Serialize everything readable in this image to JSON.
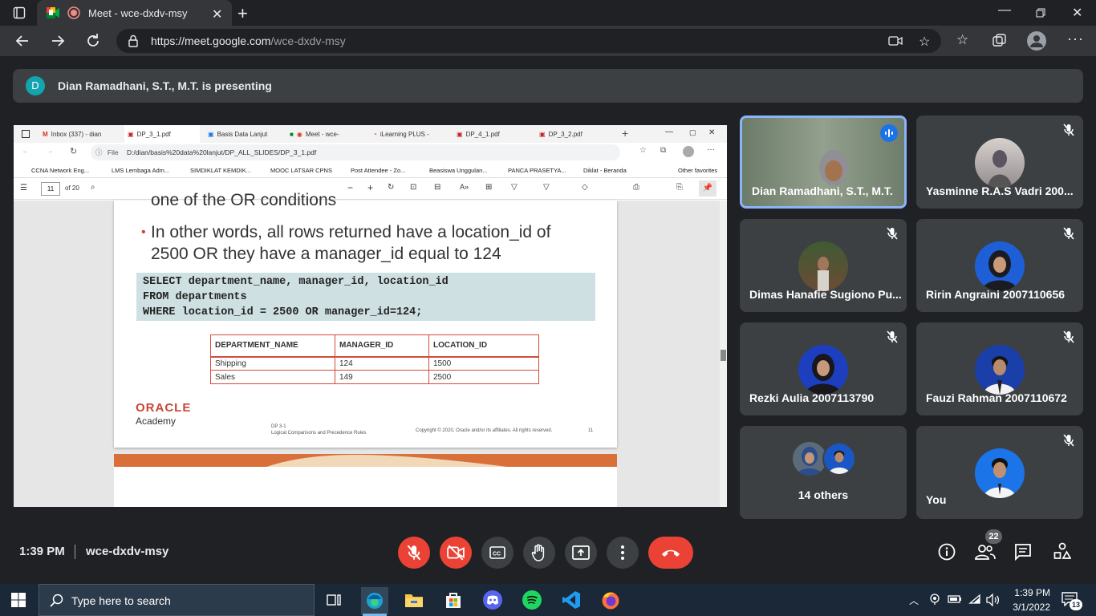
{
  "browser": {
    "tab_title": "Meet - wce-dxdv-msy",
    "url_host": "https://meet.google.com",
    "url_path": "/wce-dxdv-msy"
  },
  "meet": {
    "presenter_initial": "D",
    "presenting_text": "Dian Ramadhani, S.T., M.T. is presenting",
    "time": "1:39 PM",
    "meeting_code": "wce-dxdv-msy",
    "participants_count": "22"
  },
  "shared_screen": {
    "tabs": [
      "Inbox (337) - dian",
      "DP_3_1.pdf",
      "Basis Data Lanjut",
      "Meet - wce-",
      "iLearning PLUS -",
      "DP_4_1.pdf",
      "DP_3_2.pdf"
    ],
    "file_label": "File",
    "path": "D:/dian/basis%20data%20lanjut/DP_ALL_SLIDES/DP_3_1.pdf",
    "bookmarks": [
      "CCNA Network Eng...",
      "LMS Lembaga Adm...",
      "SIMDIKLAT KEMDIK...",
      "MOOC LATSAR CPNS",
      "Post Attendee - Zo...",
      "Beasiswa Unggulan...",
      "PANCA PRASETYA...",
      "Diklat - Beranda",
      "Other favorites"
    ],
    "page_number": "11",
    "page_total": "of 20",
    "slide": {
      "line_top": "one of the OR conditions",
      "bullet": "In other words, all rows returned have a location_id of 2500 OR they have a manager_id equal to 124",
      "code": [
        "SELECT department_name, manager_id, location_id",
        "FROM departments",
        "WHERE location_id = 2500 OR manager_id=124;"
      ],
      "table_headers": [
        "DEPARTMENT_NAME",
        "MANAGER_ID",
        "LOCATION_ID"
      ],
      "table_rows": [
        [
          "Shipping",
          "124",
          "1500"
        ],
        [
          "Sales",
          "149",
          "2500"
        ]
      ],
      "brand": "ORACLE",
      "brand_sub": "Academy",
      "footer_code": "DP 3-1",
      "footer_title": "Logical Comparisons and Precedence Rules",
      "copyright": "Copyright © 2020, Oracle and/or its affiliates. All rights reserved.",
      "slide_number": "11"
    }
  },
  "participants": [
    {
      "name": "Dian Ramadhani, S.T., M.T.",
      "speaking": true
    },
    {
      "name": "Yasminne R.A.S Vadri 200...",
      "muted": true
    },
    {
      "name": "Dimas Hanafie Sugiono Pu...",
      "muted": true
    },
    {
      "name": "Ririn Angraini 2007110656",
      "muted": true
    },
    {
      "name": "Rezki Aulia 2007113790",
      "muted": true
    },
    {
      "name": "Fauzi Rahman 2007110672",
      "muted": true
    },
    {
      "name": "14 others"
    },
    {
      "name": "You",
      "muted": true
    }
  ],
  "taskbar": {
    "search_placeholder": "Type here to search",
    "time": "1:39 PM",
    "date": "3/1/2022",
    "notifications": "13"
  },
  "colors": {
    "meet_bg": "#202124",
    "tile_bg": "#3c4043",
    "red": "#ea4335",
    "speaking_blue": "#8ab4f8",
    "oracle_red": "#c74634"
  }
}
